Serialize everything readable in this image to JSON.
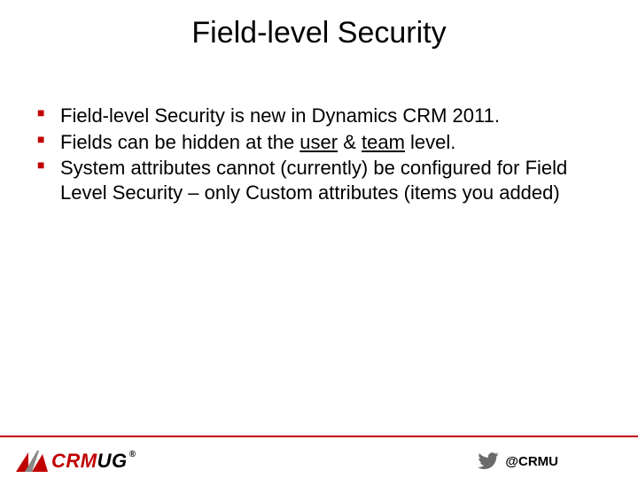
{
  "title": "Field-level Security",
  "bullets": [
    {
      "pre": "Field-level Security is new in Dynamics CRM 2011.",
      "u1": "",
      "mid": "",
      "u2": "",
      "post": ""
    },
    {
      "pre": "Fields can be hidden at the ",
      "u1": "user",
      "mid": " & ",
      "u2": "team",
      "post": " level."
    },
    {
      "pre": "System attributes cannot (currently) be configured for Field Level Security – only Custom attributes (items you added)",
      "u1": "",
      "mid": "",
      "u2": "",
      "post": ""
    }
  ],
  "logo": {
    "part1": "CRM",
    "part2": "UG",
    "registered": "®"
  },
  "twitter": {
    "handle": "@CRMU"
  },
  "colors": {
    "accent": "#C00000",
    "text": "#000000",
    "twitter": "#6b6b6b"
  }
}
